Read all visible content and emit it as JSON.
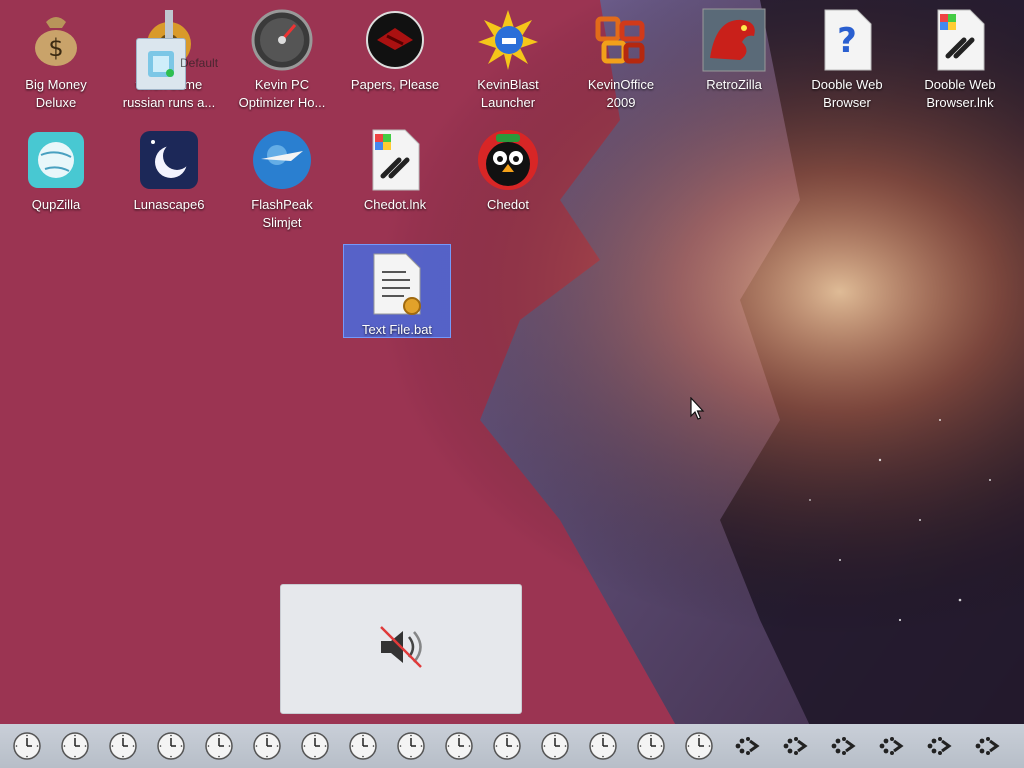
{
  "desktop_icons": [
    {
      "label": "Big Money\nDeluxe",
      "icon": "money-bag-icon"
    },
    {
      "label": "when some\nrussian runs a...",
      "icon": "gear-app-icon"
    },
    {
      "label": "Kevin PC\nOptimizer Ho...",
      "icon": "gauge-icon"
    },
    {
      "label": "Papers, Please",
      "icon": "eagle-emblem-icon"
    },
    {
      "label": "KevinBlast\nLauncher",
      "icon": "sun-globe-icon"
    },
    {
      "label": "KevinOffice\n2009",
      "icon": "office-logo-icon"
    },
    {
      "label": "RetroZilla",
      "icon": "dragon-icon"
    },
    {
      "label": "Dooble Web\nBrowser",
      "icon": "question-document-icon"
    },
    {
      "label": "Dooble Web\nBrowser.lnk",
      "icon": "shortcut-document-icon"
    },
    {
      "label": "QupZilla",
      "icon": "globe-icon"
    },
    {
      "label": "Lunascape6",
      "icon": "moon-icon"
    },
    {
      "label": "FlashPeak\nSlimjet",
      "icon": "jet-globe-icon"
    },
    {
      "label": "Chedot.lnk",
      "icon": "shortcut-document-icon"
    },
    {
      "label": "Chedot",
      "icon": "bird-icon"
    },
    {
      "label": "Text File.bat",
      "icon": "batch-file-icon"
    }
  ],
  "drag_ghost_text": "Default",
  "osd": {
    "icon": "speaker-muted-icon"
  },
  "taskbar": {
    "clock_icons": 15,
    "busy_icons": 6,
    "clock_icon_name": "clock-icon",
    "busy_icon_name": "busy-dots-icon"
  },
  "colors": {
    "selection": "#466ee6",
    "osd_bg": "#e6e8ec",
    "taskbar_bg": "#c1c8d2"
  }
}
